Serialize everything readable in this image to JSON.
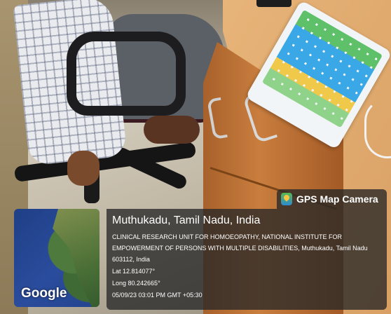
{
  "overlay": {
    "app_name": "GPS Map Camera",
    "place": "Muthukadu, Tamil Nadu, India",
    "address": "CLINICAL RESEARCH UNIT FOR HOMOEOPATHY, NATIONAL INSTITUTE FOR EMPOWERMENT OF PERSONS WITH MULTIPLE DISABILITIES, Muthukadu, Tamil Nadu 603112, India",
    "lat": "Lat 12.814077°",
    "long": "Long 80.242665°",
    "datetime": "05/09/23 03:01 PM GMT +05:30",
    "map_label": "Google"
  },
  "icons": {
    "app": "gps-map-camera-icon"
  }
}
